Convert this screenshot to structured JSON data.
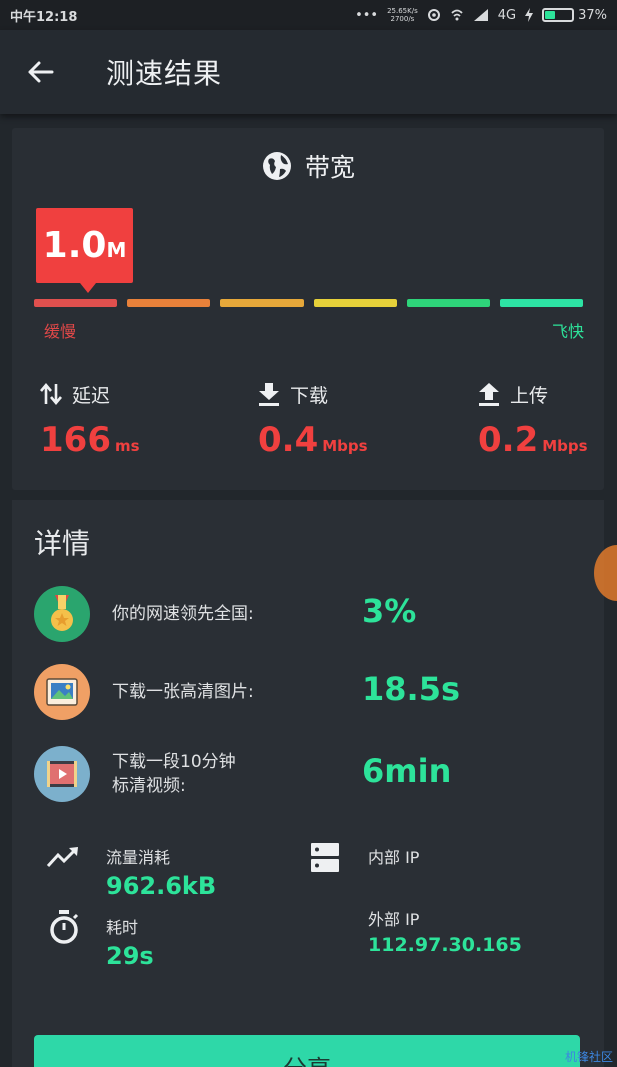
{
  "status_bar": {
    "time": "中午12:18",
    "net_speed_top": "25.65K/s",
    "net_speed_bottom": "2700/s",
    "network": "4G",
    "battery": "37%",
    "battery_level": 0.37
  },
  "app_bar": {
    "title": "测速结果",
    "back_icon": "arrow-left-icon"
  },
  "bandwidth": {
    "title": "带宽",
    "icon": "globe-icon",
    "speed_value": "1.0",
    "speed_unit": "M",
    "scale_slow": "缓慢",
    "scale_fast": "飞快",
    "scale_colors": [
      "#e0504e",
      "#e8813a",
      "#e6a83a",
      "#e6d13a",
      "#2ed47a",
      "#2de3a4"
    ],
    "metrics": {
      "latency": {
        "label": "延迟",
        "value": "166",
        "unit": "ms",
        "icon": "swap-vertical-icon"
      },
      "download": {
        "label": "下载",
        "value": "0.4",
        "unit": "Mbps",
        "icon": "download-icon"
      },
      "upload": {
        "label": "上传",
        "value": "0.2",
        "unit": "Mbps",
        "icon": "upload-icon"
      }
    }
  },
  "details": {
    "title": "详情",
    "rows": [
      {
        "label": "你的网速领先全国:",
        "value": "3%",
        "icon": "medal-icon",
        "color": "#2aa56e"
      },
      {
        "label": "下载一张高清图片:",
        "value": "18.5s",
        "icon": "image-icon",
        "color": "#f0a065"
      },
      {
        "label_line1": "下载一段10分钟",
        "label_line2": "标清视频:",
        "value": "6min",
        "icon": "video-icon",
        "color": "#7cb0cc"
      }
    ],
    "traffic": {
      "label": "流量消耗",
      "value": "962.6kB",
      "icon": "trend-up-icon"
    },
    "internal_ip": {
      "label": "内部 IP",
      "value": "",
      "icon": "server-icon"
    },
    "elapsed": {
      "label": "耗时",
      "value": "29s",
      "icon": "stopwatch-icon"
    },
    "external_ip": {
      "label": "外部 IP",
      "value": "112.97.30.165"
    },
    "share_label": "分享"
  },
  "watermark": "机锋社区"
}
